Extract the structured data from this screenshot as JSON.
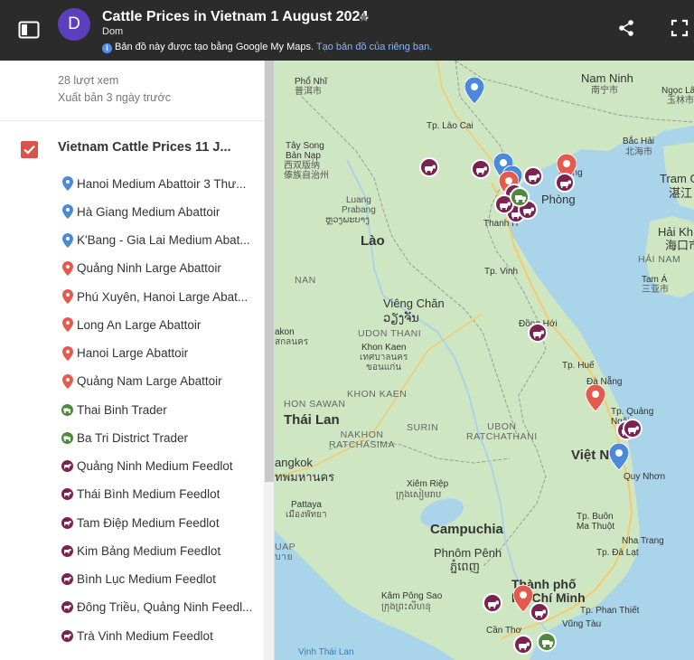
{
  "header": {
    "avatar_letter": "D",
    "title": "Cattle Prices in Vietnam 1 August 2024",
    "author": "Dom",
    "notice_text": "Bản đồ này được tạo bằng Google My Maps.",
    "notice_link": "Tạo bản đồ của riêng bạn."
  },
  "sidebar": {
    "views": "28 lượt xem",
    "published": "Xuất bản 3 ngày trước",
    "layer_title": "Vietnam Cattle Prices 11 J...",
    "items": [
      {
        "label": "Hanoi Medium Abattoir 3 Thư...",
        "icon": "blue-pin"
      },
      {
        "label": "Hà Giang Medium Abattoir",
        "icon": "blue-pin"
      },
      {
        "label": "K'Bang - Gia Lai Medium Abat...",
        "icon": "blue-pin"
      },
      {
        "label": "Quảng Ninh Large Abattoir",
        "icon": "red-pin"
      },
      {
        "label": "Phú Xuyên, Hanoi Large Abat...",
        "icon": "red-pin"
      },
      {
        "label": "Long An Large Abattoir",
        "icon": "red-pin"
      },
      {
        "label": "Hanoi Large Abattoir",
        "icon": "red-pin"
      },
      {
        "label": "Quảng Nam Large Abattoir",
        "icon": "red-pin"
      },
      {
        "label": "Thai Binh Trader",
        "icon": "green-truck"
      },
      {
        "label": "Ba Tri District Trader",
        "icon": "green-truck"
      },
      {
        "label": "Quảng Ninh Medium Feedlot",
        "icon": "maroon-cow"
      },
      {
        "label": "Thái Bình Medium Feedlot",
        "icon": "maroon-cow"
      },
      {
        "label": "Tam Điệp Medium Feedlot",
        "icon": "maroon-cow"
      },
      {
        "label": "Kim Bảng Medium Feedlot",
        "icon": "maroon-cow"
      },
      {
        "label": "Bình Lục Medium Feedlot",
        "icon": "maroon-cow"
      },
      {
        "label": "Đông Triều, Quảng Ninh Feedl...",
        "icon": "maroon-cow"
      },
      {
        "label": "Trà Vinh Medium Feedlot",
        "icon": "maroon-cow"
      }
    ]
  },
  "map": {
    "labels": {
      "nam_ninh": "Nam Ninh",
      "nam_ninh_cn": "南宁市",
      "pho_nhi": "Phổ Nhĩ",
      "pho_nhi_cn": "普洱市",
      "ngoc_lam": "Ngọc Lâ",
      "ngoc_lam_cn": "玉林市",
      "tp_lao_cai": "Tp. Lào Cai",
      "bac_hai": "Bắc Hải",
      "bac_hai_cn": "北海市",
      "tram_g": "Tram G",
      "tram_g_cn": "湛江",
      "tay_song_ban_nap": "Tây Song\nBản Nạp",
      "tay_song_cn": "西双版纳\n傣族自治州",
      "hang": "Hạ ng",
      "phong": "Phòng",
      "thanh_h": "Thanh H",
      "luang_prabang": "Luang\nPrabang",
      "luang_prabang_lo": "ຫຼວງພະບາງ",
      "lao": "Lào",
      "hai_kh": "Hải Kh",
      "hai_kh_cn": "海口市",
      "hai_nam": "HẢI NAM",
      "tam_a": "Tam Á",
      "tam_a_cn": "三亚市",
      "tp_vinh": "Tp. Vinh",
      "nan": "NAN",
      "vieng_chan": "Viêng Chăn",
      "vieng_chan_lo": "ວຽງຈັນ",
      "dong_hoi": "Đồng Hới",
      "sakon": "akon",
      "sakon_th": "สกลนคร",
      "udon_thani": "UDON THANI",
      "khon_kaen": "Khon Kaen",
      "khon_kaen_th": "เทศบาลนคร\nขอนแก่น",
      "tp_hue": "Tp. Huế",
      "da_nang": "Đà Nẵng",
      "khon_kaen_region": "KHON KAEN",
      "tp_quang_ngai": "Tp. Quảng\nNgãi",
      "hon_sawan": "HON SAWAN",
      "thai_lan": "Thái Lan",
      "surin": "SURIN",
      "ubon_ratchathani": "UBON\nRATCHATHANI",
      "nakhon_ratchasima": "NAKHON\nRATCHASIMA",
      "viet_nam": "Việt Nam",
      "bangkok": "angkok",
      "bangkok_th": "ทพมหานคร",
      "quy_nhon": "Quy Nhơn",
      "xiem_riep": "Xiêm Riệp",
      "xiem_riep_km": "ក្រុងសៀមរាប",
      "pattaya": "Pattaya",
      "pattaya_th": "เมืองพัทยา",
      "campuchia": "Campuchia",
      "tp_buon_ma_thuot": "Tp. Buôn\nMa Thuột",
      "nha_trang": "Nha Trang",
      "rayong": "UAP\nบาย",
      "phnom_penh": "Phnôm Pênh",
      "phnom_penh_km": "ភ្នំពេញ",
      "tp_da_lat": "Tp. Đà Lạt",
      "thanh_pho": "Thành phố",
      "ho_chi_minh": "Hồ Chí Minh",
      "kampong_som": "Kâm Pông Sao",
      "kampong_som_km": "ក្រុងព្រះសីហនុ",
      "tp_phan_thiet": "Tp. Phan Thiết",
      "vung_tau": "Vũng Tàu",
      "can_tho": "Cần Thơ",
      "vinh_thai_lan": "Vịnh Thái Lan"
    }
  },
  "colors": {
    "header_bg": "#2b2b2b",
    "avatar": "#5b3fbf",
    "checkbox": "#d9534a",
    "blue_pin": "#4a89dc",
    "red_pin": "#e65a4e",
    "maroon_cow": "#7b2350",
    "green_truck": "#4e8a3e",
    "land": "#cfe6c3",
    "sea": "#a9d4e9"
  }
}
